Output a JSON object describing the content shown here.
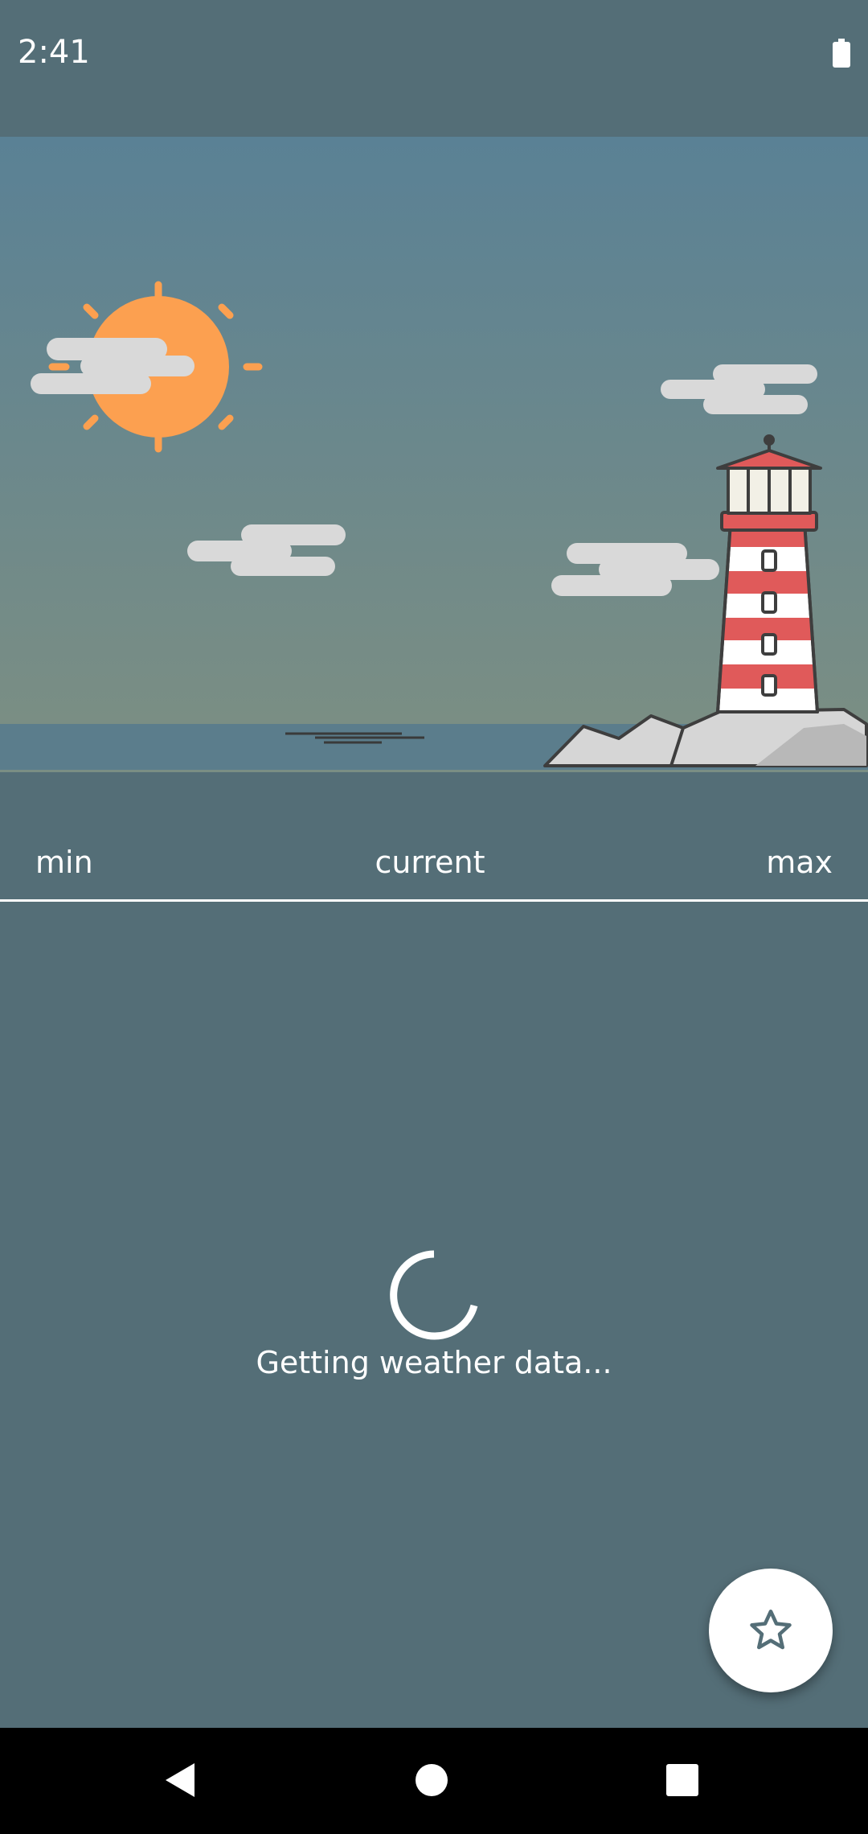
{
  "status_bar": {
    "time": "2:41",
    "battery_icon": "battery-full-icon"
  },
  "scene": {
    "illustration": "lighthouse-sea-sun-clouds",
    "colors": {
      "sky_top": "#5a8195",
      "sky_bottom": "#7a8e84",
      "sea": "#5b7d8c",
      "sun": "#fca050",
      "cloud": "#d9d9d9",
      "lighthouse_red": "#e05a5a"
    }
  },
  "temps": {
    "min_label": "min",
    "current_label": "current",
    "max_label": "max"
  },
  "loading": {
    "text": "Getting weather data..."
  },
  "fab": {
    "icon": "star-outline-icon",
    "icon_color": "#546e77"
  },
  "nav": {
    "back_icon": "back-triangle-icon",
    "home_icon": "home-circle-icon",
    "recents_icon": "recents-square-icon"
  },
  "colors": {
    "background": "#546e77",
    "text": "#ffffff"
  }
}
